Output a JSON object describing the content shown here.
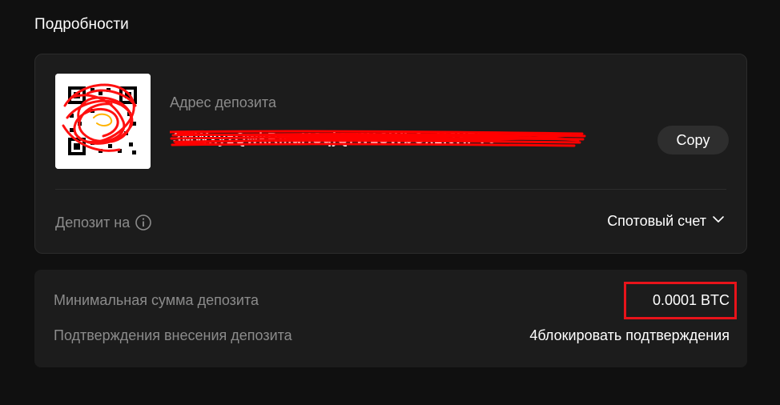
{
  "section": {
    "title": "Подробности"
  },
  "deposit": {
    "address_label": "Адрес депозита",
    "address_value": "3MWxyzQwkRmaHSqjQrW1SWbGx1lJXPV9",
    "copy_label": "Copy",
    "deposit_to_label": "Депозит на",
    "account_value": "Спотовый счет"
  },
  "info": {
    "rows": [
      {
        "label": "Минимальная сумма депозита",
        "value": "0.0001 BTC"
      },
      {
        "label": "Подтверждения внесения депозита",
        "value": "4блокировать подтверждения"
      }
    ]
  },
  "icons": {
    "qr": "qr-code-icon",
    "info": "info-circle-icon",
    "chevron": "chevron-down-icon"
  },
  "colors": {
    "background": "#101010",
    "card": "#1c1c1c",
    "muted_text": "#8b8b8b",
    "highlight": "#e8131a",
    "scribble": "#ff0000"
  }
}
